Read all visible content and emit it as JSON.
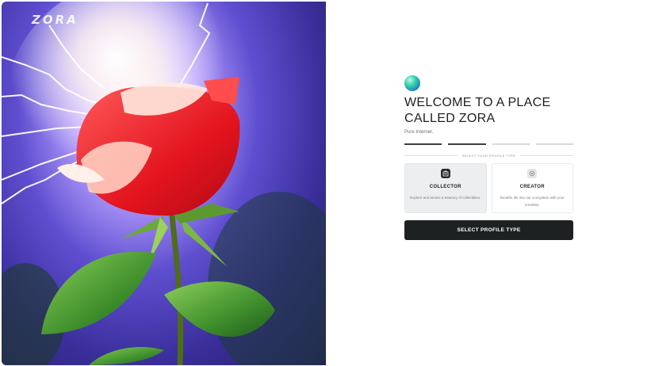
{
  "brand": {
    "logo_text": "ZORA"
  },
  "hero": {
    "image_description_icon": "rose-lightning-image"
  },
  "onboarding": {
    "title": "WELCOME TO A PLACE CALLED ZORA",
    "subtitle": "Pure Internet.",
    "steps_total": 4,
    "steps_completed": 2,
    "section_label": "SELECT YOUR PROFILE TYPE",
    "options": [
      {
        "name": "COLLECTOR",
        "description": "Explore and amass a treasury of collectibles.",
        "icon": "collector-icon",
        "selected": true
      },
      {
        "name": "CREATOR",
        "description": "Breathe life into our ecosystem with your creativity.",
        "icon": "creator-icon",
        "selected": false
      }
    ],
    "cta_label": "SELECT PROFILE TYPE"
  },
  "colors": {
    "primary_button": "#1e2122",
    "selected_card": "#eceef0",
    "orb_gradient": [
      "#b9fbe0",
      "#3fd1b0",
      "#1d8fb8"
    ]
  }
}
